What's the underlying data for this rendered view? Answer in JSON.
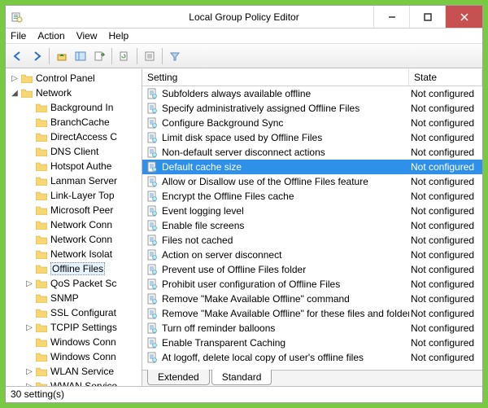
{
  "window": {
    "title": "Local Group Policy Editor"
  },
  "menubar": [
    "File",
    "Action",
    "View",
    "Help"
  ],
  "tree": {
    "root_nodes": [
      {
        "label": "Control Panel",
        "expander": "▷",
        "indent": 0,
        "selected": false
      },
      {
        "label": "Network",
        "expander": "◢",
        "indent": 0,
        "selected": false
      }
    ],
    "children": [
      {
        "label": "Background In",
        "indent": 1
      },
      {
        "label": "BranchCache",
        "indent": 1
      },
      {
        "label": "DirectAccess C",
        "indent": 1
      },
      {
        "label": "DNS Client",
        "indent": 1
      },
      {
        "label": "Hotspot Authe",
        "indent": 1
      },
      {
        "label": "Lanman Server",
        "indent": 1
      },
      {
        "label": "Link-Layer Top",
        "indent": 1
      },
      {
        "label": "Microsoft Peer",
        "indent": 1
      },
      {
        "label": "Network Conn",
        "indent": 1
      },
      {
        "label": "Network Conn",
        "indent": 1
      },
      {
        "label": "Network Isolat",
        "indent": 1
      },
      {
        "label": "Offline Files",
        "indent": 1,
        "selected": true
      },
      {
        "label": "QoS Packet Sc",
        "indent": 1,
        "expander": "▷"
      },
      {
        "label": "SNMP",
        "indent": 1
      },
      {
        "label": "SSL Configurat",
        "indent": 1
      },
      {
        "label": "TCPIP Settings",
        "indent": 1,
        "expander": "▷"
      },
      {
        "label": "Windows Conn",
        "indent": 1
      },
      {
        "label": "Windows Conn",
        "indent": 1
      },
      {
        "label": "WLAN Service",
        "indent": 1,
        "expander": "▷"
      },
      {
        "label": "WWAN Service",
        "indent": 1,
        "expander": "▷"
      }
    ]
  },
  "list": {
    "columns": {
      "setting": "Setting",
      "state": "State"
    },
    "rows": [
      {
        "setting": "Subfolders always available offline",
        "state": "Not configured",
        "selected": false
      },
      {
        "setting": "Specify administratively assigned Offline Files",
        "state": "Not configured",
        "selected": false
      },
      {
        "setting": "Configure Background Sync",
        "state": "Not configured",
        "selected": false
      },
      {
        "setting": "Limit disk space used by Offline Files",
        "state": "Not configured",
        "selected": false
      },
      {
        "setting": "Non-default server disconnect actions",
        "state": "Not configured",
        "selected": false
      },
      {
        "setting": "Default cache size",
        "state": "Not configured",
        "selected": true
      },
      {
        "setting": "Allow or Disallow use of the Offline Files feature",
        "state": "Not configured",
        "selected": false
      },
      {
        "setting": "Encrypt the Offline Files cache",
        "state": "Not configured",
        "selected": false
      },
      {
        "setting": "Event logging level",
        "state": "Not configured",
        "selected": false
      },
      {
        "setting": "Enable file screens",
        "state": "Not configured",
        "selected": false
      },
      {
        "setting": "Files not cached",
        "state": "Not configured",
        "selected": false
      },
      {
        "setting": "Action on server disconnect",
        "state": "Not configured",
        "selected": false
      },
      {
        "setting": "Prevent use of Offline Files folder",
        "state": "Not configured",
        "selected": false
      },
      {
        "setting": "Prohibit user configuration of Offline Files",
        "state": "Not configured",
        "selected": false
      },
      {
        "setting": "Remove \"Make Available Offline\" command",
        "state": "Not configured",
        "selected": false
      },
      {
        "setting": "Remove \"Make Available Offline\" for these files and folders",
        "state": "Not configured",
        "selected": false
      },
      {
        "setting": "Turn off reminder balloons",
        "state": "Not configured",
        "selected": false
      },
      {
        "setting": "Enable Transparent Caching",
        "state": "Not configured",
        "selected": false
      },
      {
        "setting": "At logoff, delete local copy of user's offline files",
        "state": "Not configured",
        "selected": false
      }
    ]
  },
  "tabs": {
    "extended": "Extended",
    "standard": "Standard"
  },
  "statusbar": "30 setting(s)"
}
